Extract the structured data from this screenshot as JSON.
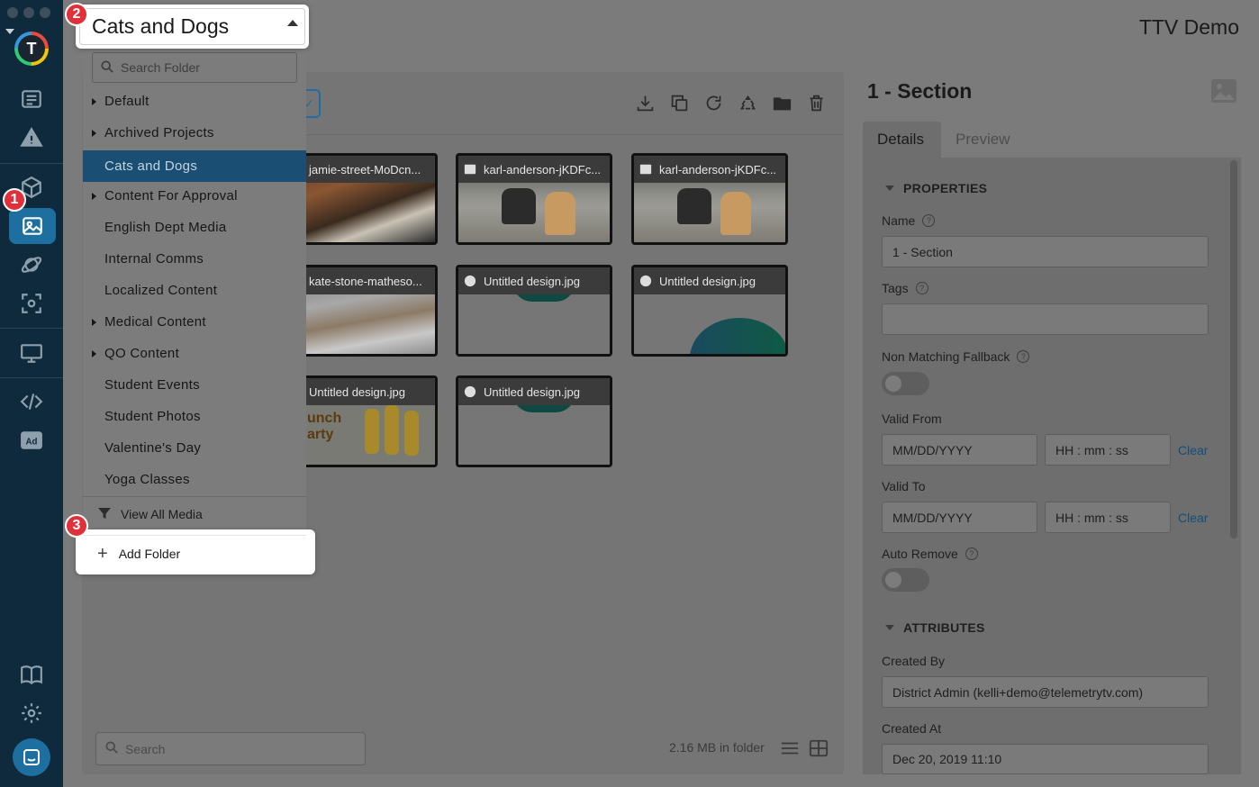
{
  "app": {
    "title": "TTV Demo",
    "logo_letter": "T"
  },
  "annotations": {
    "badge1": "1",
    "badge2": "2",
    "badge3": "3"
  },
  "sidebar": {
    "icons": [
      "playlist-icon",
      "alert-icon",
      "cube-icon",
      "image-icon",
      "satellite-icon",
      "screenshot-icon",
      "monitor-icon",
      "code-icon",
      "ad-icon",
      "book-icon",
      "gear-icon",
      "chat-icon"
    ],
    "active": "image-icon",
    "ad_label": "Ad"
  },
  "folder_dropdown": {
    "selected": "Cats and Dogs",
    "search_placeholder": "Search Folder",
    "items": [
      {
        "label": "Default",
        "has_children": true
      },
      {
        "label": "Archived Projects",
        "has_children": true
      },
      {
        "label": "Cats and Dogs",
        "has_children": false,
        "selected": true
      },
      {
        "label": "Content For Approval",
        "has_children": true
      },
      {
        "label": "English Dept Media",
        "has_children": false
      },
      {
        "label": "Internal Comms",
        "has_children": false
      },
      {
        "label": "Localized Content",
        "has_children": false
      },
      {
        "label": "Medical Content",
        "has_children": true
      },
      {
        "label": "QO Content",
        "has_children": true
      },
      {
        "label": "Student Events",
        "has_children": false
      },
      {
        "label": "Student Photos",
        "has_children": false
      },
      {
        "label": "Valentine's Day",
        "has_children": false
      },
      {
        "label": "Yoga Classes",
        "has_children": false
      }
    ],
    "view_all": "View All Media",
    "add_folder": "Add Folder"
  },
  "media": {
    "cards": [
      {
        "name": "jamie-street-MoDcn...",
        "icon": "image-icon",
        "thumb": "dog-glasses"
      },
      {
        "name": "karl-anderson-jKDFc...",
        "icon": "image-icon",
        "thumb": "dogs-snow"
      },
      {
        "name": "karl-anderson-jKDFc...",
        "icon": "image-icon",
        "thumb": "dogs-snow"
      },
      {
        "name": "kate-stone-matheso...",
        "icon": "image-icon",
        "thumb": "cat-blanket"
      },
      {
        "name": "Untitled design.jpg",
        "icon": "palette-icon",
        "thumb": "design-arc-top"
      },
      {
        "name": "Untitled design.jpg",
        "icon": "palette-icon",
        "thumb": "design-circle"
      },
      {
        "name": "Untitled design.jpg",
        "icon": "palette-icon",
        "thumb": "lunch-party"
      },
      {
        "name": "Untitled design.jpg",
        "icon": "palette-icon",
        "thumb": "design-arc-top"
      }
    ],
    "lunch_party_text": "unch\narty",
    "search_placeholder": "Search",
    "folder_size": "2.16 MB in folder"
  },
  "details": {
    "title": "1 - Section",
    "tabs": [
      "Details",
      "Preview"
    ],
    "properties_header": "PROPERTIES",
    "name_label": "Name",
    "name_value": "1 - Section",
    "tags_label": "Tags",
    "tags_value": "",
    "fallback_label": "Non Matching Fallback",
    "fallback_on": false,
    "valid_from_label": "Valid From",
    "valid_to_label": "Valid To",
    "date_placeholder": "MM/DD/YYYY",
    "time_placeholder": "HH : mm : ss",
    "clear": "Clear",
    "auto_remove_label": "Auto Remove",
    "auto_remove_on": false,
    "attributes_header": "ATTRIBUTES",
    "created_by_label": "Created By",
    "created_by_value": "District Admin (kelli+demo@telemetrytv.com)",
    "created_at_label": "Created At",
    "created_at_value": "Dec 20, 2019 11:10"
  },
  "colors": {
    "rail": "#0e2a3c",
    "accent": "#1d6fa0",
    "badge": "#e0303a",
    "selected_folder": "#1a4f73"
  }
}
